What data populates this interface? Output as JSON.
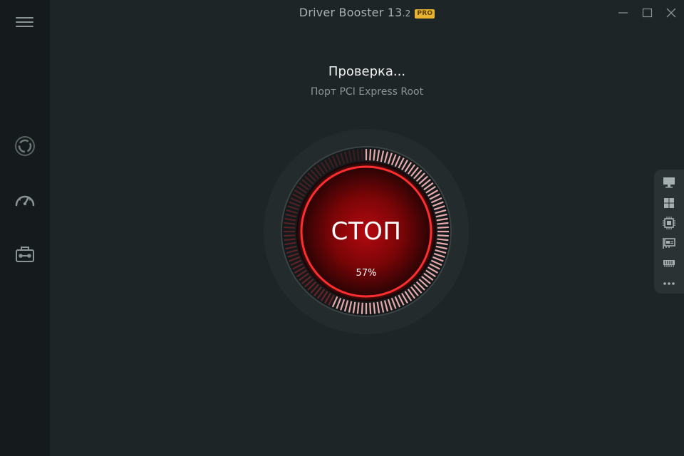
{
  "app": {
    "name": "Driver Booster 13",
    "version_suffix": ".2",
    "badge": "PRO"
  },
  "scan": {
    "status_title": "Проверка...",
    "current_item": "Порт PCI Express Root",
    "stop_label": "СТОП",
    "progress_text": "57%",
    "progress": 0.57
  },
  "colors": {
    "accent": "#e8202a",
    "background": "#1e2526",
    "sidebar": "#151b1c",
    "badge": "#e8b330"
  },
  "sidebar": {
    "icons": [
      "menu-icon",
      "refresh-scan-icon",
      "speedometer-icon",
      "toolbox-icon"
    ]
  },
  "right_panel": {
    "icons": [
      "monitor-icon",
      "windows-icon",
      "cpu-chip-icon",
      "network-card-icon",
      "memory-icon",
      "more-icon"
    ]
  }
}
